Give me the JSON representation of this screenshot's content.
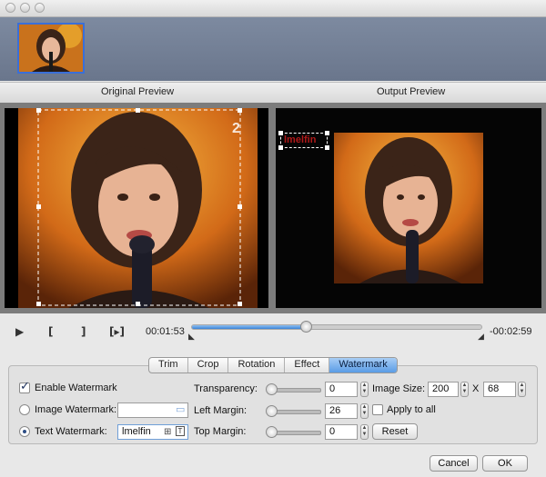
{
  "preview": {
    "original_label": "Original Preview",
    "output_label": "Output Preview",
    "channel_logo": "2",
    "output_watermark_text": "lmelfin"
  },
  "playback": {
    "current_time": "00:01:53",
    "remaining_time": "-00:02:59",
    "progress_fraction": 0.39
  },
  "tabs": [
    {
      "label": "Trim",
      "active": false
    },
    {
      "label": "Crop",
      "active": false
    },
    {
      "label": "Rotation",
      "active": false
    },
    {
      "label": "Effect",
      "active": false
    },
    {
      "label": "Watermark",
      "active": true
    }
  ],
  "watermark": {
    "enable_label": "Enable Watermark",
    "enabled": true,
    "image_label": "Image Watermark:",
    "image_value": "",
    "text_label": "Text Watermark:",
    "text_value": "lmelfin",
    "mode": "text",
    "transparency_label": "Transparency:",
    "transparency_value": "0",
    "left_margin_label": "Left Margin:",
    "left_margin_value": "26",
    "top_margin_label": "Top  Margin:",
    "top_margin_value": "0",
    "image_size_label": "Image Size:",
    "width_value": "200",
    "x_label": "X",
    "height_value": "68",
    "apply_all_label": "Apply to all",
    "apply_all": false,
    "reset_label": "Reset"
  },
  "footer": {
    "cancel_label": "Cancel",
    "ok_label": "OK"
  },
  "colors": {
    "accent": "#3b83d6",
    "watermark_text": "#b01818"
  }
}
